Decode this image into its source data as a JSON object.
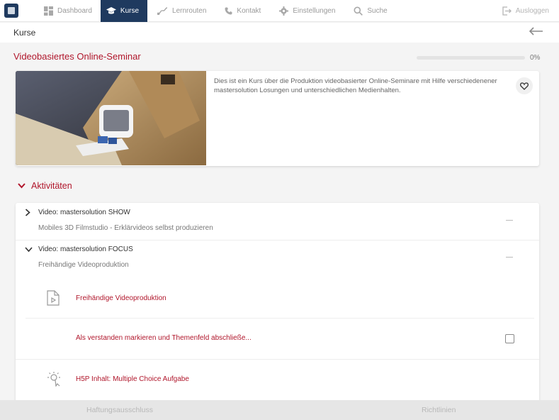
{
  "nav": {
    "items": [
      {
        "label": "Dashboard",
        "icon": "grid-icon"
      },
      {
        "label": "Kurse",
        "icon": "graduation-cap-icon",
        "active": true
      },
      {
        "label": "Lernrouten",
        "icon": "route-icon"
      },
      {
        "label": "Kontakt",
        "icon": "phone-icon"
      },
      {
        "label": "Einstellungen",
        "icon": "gear-icon"
      },
      {
        "label": "Suche",
        "icon": "search-icon"
      }
    ],
    "logout_label": "Ausloggen"
  },
  "header": {
    "title": "Kurse"
  },
  "course": {
    "title": "Videobasiertes Online-Seminar",
    "progress_label": "0%",
    "progress_fraction": 0,
    "description": "Dies ist ein Kurs über die Produktion videobasierter Online-Seminare mit Hilfe verschiedenener mastersolution Losungen und unterschiedlichen Medienhalten."
  },
  "activities": {
    "heading": "Aktivitäten",
    "sections": [
      {
        "title": "Video: mastersolution SHOW",
        "subtitle": "Mobiles 3D Filmstudio - Erklärvideos selbst produzieren",
        "expanded": false
      },
      {
        "title": "Video: mastersolution FOCUS",
        "subtitle": "Freihändige Videoproduktion",
        "expanded": true
      }
    ],
    "items": [
      {
        "label": "Freihändige Videoproduktion",
        "icon": "video-file-icon"
      },
      {
        "label": "Als verstanden markieren und Themenfeld abschließe...",
        "checked": false
      },
      {
        "label": "H5P Inhalt: Multiple Choice Aufgabe",
        "icon": "h5p-bulb-icon"
      }
    ]
  },
  "bottom": {
    "left_label": "Haftungsausschluss",
    "right_label": "Richtlinien"
  },
  "colors": {
    "accent": "#b0162b",
    "nav_active": "#1f3a5f"
  }
}
